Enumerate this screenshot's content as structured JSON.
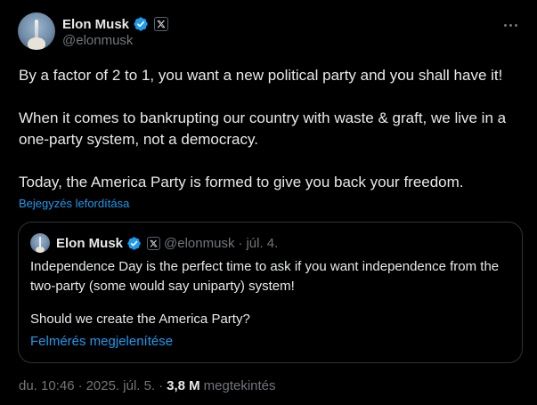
{
  "author": {
    "display_name": "Elon Musk",
    "handle": "@elonmusk",
    "avatar_icon": "avatar-rocket-icon",
    "verified_color": "#1d9bf0"
  },
  "post": {
    "paragraphs": [
      "By a factor of 2 to 1, you want a new political party and you shall have it!",
      "When it comes to bankrupting our country with waste & graft, we live in a one-party system, not a democracy.",
      "Today, the America Party is formed to give you back your freedom."
    ],
    "translate_label": "Bejegyzés lefordítása"
  },
  "quote": {
    "display_name": "Elon Musk",
    "handle": "@elonmusk",
    "separator": "·",
    "date": "júl. 4.",
    "paragraphs": [
      "Independence Day is the perfect time to ask if you want independence from the two-party (some would say uniparty) system!",
      "Should we create the America Party?"
    ],
    "poll_link": "Felmérés megjelenítése"
  },
  "meta": {
    "time": "du. 10:46",
    "separator": "·",
    "date": "2025. júl. 5.",
    "views_count": "3,8 M",
    "views_label": "megtekintés"
  },
  "colors": {
    "background": "#000000",
    "text": "#e7e9ea",
    "muted": "#71767b",
    "accent": "#1d9bf0",
    "border": "#2f3336"
  }
}
